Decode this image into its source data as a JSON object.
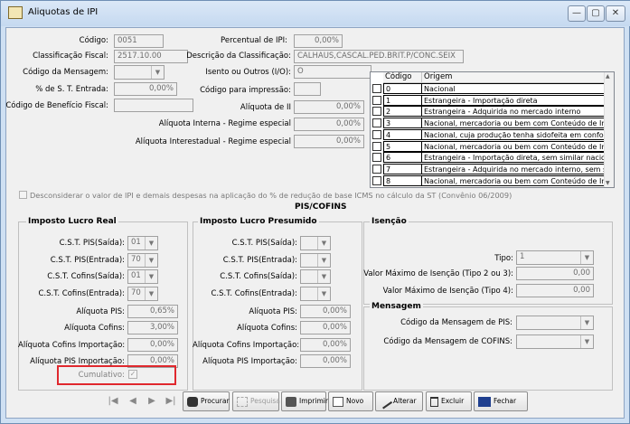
{
  "window": {
    "title": "Aliquotas de IPI",
    "minimize": "—",
    "maximize": "▢",
    "close": "✕"
  },
  "form": {
    "codigo": {
      "label": "Código:",
      "value": "0051"
    },
    "percentual_ipi": {
      "label": "Percentual de IPI:",
      "value": "0,00%"
    },
    "classificacao_fiscal": {
      "label": "Classificação Fiscal:",
      "value": "2517.10.00"
    },
    "descricao_classificacao": {
      "label": "Descrição da Classificação:",
      "value": "CALHAUS,CASCAL.PED.BRIT.P/CONC.SEIX"
    },
    "codigo_mensagem": {
      "label": "Código da Mensagem:",
      "value": ""
    },
    "isento_outros": {
      "label": "Isento ou Outros (I/O):",
      "value": "O"
    },
    "pct_st_entrada": {
      "label": "% de S. T. Entrada:",
      "value": "0,00%"
    },
    "codigo_impressao": {
      "label": "Código para impressão:",
      "value": ""
    },
    "codigo_beneficio": {
      "label": "Código de Benefício Fiscal:",
      "value": ""
    },
    "aliquota_ii": {
      "label": "Alíquota de II",
      "value": "0,00%"
    },
    "aliq_interna": {
      "label": "Alíquota Interna - Regime especial",
      "value": "0,00%"
    },
    "aliq_interestadual": {
      "label": "Alíquota Interestadual - Regime especial",
      "value": "0,00%"
    },
    "desconsiderar": "Desconsiderar o valor de IPI e demais despesas na aplicação do % de redução de base ICMS no cálculo da ST (Convênio 06/2009)"
  },
  "origem_table": {
    "headers": [
      "Código",
      "Origem"
    ],
    "rows": [
      [
        "0",
        "Nacional"
      ],
      [
        "1",
        "Estrangeira - Importação direta"
      ],
      [
        "2",
        "Estrangeira - Adquirida no mercado interno"
      ],
      [
        "3",
        "Nacional, mercadoria ou bem com Conteúdo de Impor"
      ],
      [
        "4",
        "Nacional, cuja produção tenha sidofeita em conformid"
      ],
      [
        "5",
        "Nacional, mercadoria ou bem com Conteúdo de Impor"
      ],
      [
        "6",
        "Estrangeira - Importação direta, sem similar nacional,"
      ],
      [
        "7",
        "Estrangeira - Adquirida no mercado interno, sem simila"
      ],
      [
        "8",
        "Nacional, mercadoria ou bem com Conteúdo de Impor"
      ]
    ]
  },
  "pis_cofins_title": "PIS/COFINS",
  "lucro_real": {
    "title": "Imposto Lucro Real",
    "cst_pis_saida": {
      "label": "C.S.T. PIS(Saída):",
      "value": "01"
    },
    "cst_pis_entrada": {
      "label": "C.S.T. PIS(Entrada):",
      "value": "70"
    },
    "cst_cofins_saida": {
      "label": "C.S.T. Cofins(Saída):",
      "value": "01"
    },
    "cst_cofins_entrada": {
      "label": "C.S.T. Cofins(Entrada):",
      "value": "70"
    },
    "aliq_pis": {
      "label": "Alíquota PIS:",
      "value": "0,65%"
    },
    "aliq_cofins": {
      "label": "Alíquota Cofins:",
      "value": "3,00%"
    },
    "aliq_cofins_imp": {
      "label": "Alíquota Cofins Importação:",
      "value": "0,00%"
    },
    "aliq_pis_imp": {
      "label": "Alíquota PIS Importação:",
      "value": "0,00%"
    },
    "cumulativo": "Cumulativo:"
  },
  "lucro_presumido": {
    "title": "Imposto Lucro Presumido",
    "cst_pis_saida": {
      "label": "C.S.T. PIS(Saída):",
      "value": ""
    },
    "cst_pis_entrada": {
      "label": "C.S.T. PIS(Entrada):",
      "value": ""
    },
    "cst_cofins_saida": {
      "label": "C.S.T. Cofins(Saída):",
      "value": ""
    },
    "cst_cofins_entrada": {
      "label": "C.S.T. Cofins(Entrada):",
      "value": ""
    },
    "aliq_pis": {
      "label": "Alíquota PIS:",
      "value": "0,00%"
    },
    "aliq_cofins": {
      "label": "Alíquota Cofins:",
      "value": "0,00%"
    },
    "aliq_cofins_imp": {
      "label": "Alíquota Cofins Importação:",
      "value": "0,00%"
    },
    "aliq_pis_imp": {
      "label": "Alíquota PIS Importação:",
      "value": "0,00%"
    }
  },
  "isencao": {
    "title": "Isenção",
    "tipo": {
      "label": "Tipo:",
      "value": "1"
    },
    "valor_max_2_3": {
      "label": "Valor Máximo de Isenção (Tipo 2 ou 3):",
      "value": "0,00"
    },
    "valor_max_4": {
      "label": "Valor Máximo de Isenção (Tipo 4):",
      "value": "0,00"
    }
  },
  "mensagem": {
    "title": "Mensagem",
    "cod_msg_pis": {
      "label": "Código da Mensagem de PIS:",
      "value": ""
    },
    "cod_msg_cofins": {
      "label": "Código da Mensagem de COFINS:",
      "value": ""
    }
  },
  "toolbar": {
    "procurar": "Procurar",
    "pesquisa": "Pesquisa",
    "imprimir": "Imprimir",
    "novo": "Novo",
    "alterar": "Alterar",
    "excluir": "Excluir",
    "fechar": "Fechar",
    "nav_first": "|◀",
    "nav_prev": "◀",
    "nav_next": "▶",
    "nav_last": "▶|"
  }
}
